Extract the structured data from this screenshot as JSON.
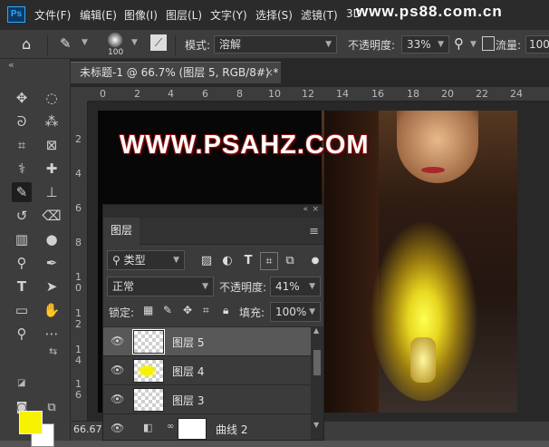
{
  "app": {
    "logo": "Ps"
  },
  "menu": [
    "文件(F)",
    "编辑(E)",
    "图像(I)",
    "图层(L)",
    "文字(Y)",
    "选择(S)",
    "滤镜(T)",
    "3D"
  ],
  "watermark": "www.ps88.com.cn",
  "options": {
    "brush_size": "100",
    "mode_label": "模式:",
    "mode_value": "溶解",
    "opacity_label": "不透明度:",
    "opacity_value": "33%",
    "flow_label": "流量:",
    "flow_value": "100"
  },
  "tools": {
    "expand": "«"
  },
  "document": {
    "tab_title": "未标题-1 @ 66.7% (图层 5, RGB/8#) *",
    "close": "×",
    "ruler_h": [
      "0",
      "2",
      "4",
      "6",
      "8",
      "10",
      "12",
      "14",
      "16",
      "18",
      "20",
      "22",
      "24"
    ],
    "ruler_v": [
      "2",
      "4",
      "6",
      "8",
      "1 0",
      "1 2",
      "1 4",
      "1 6",
      "1 8"
    ],
    "canvas_text": "WWW.PSAHZ.COM",
    "zoom": "66.67"
  },
  "colors": {
    "foreground": "#f7f200",
    "background": "#ffffff",
    "accent": "#31a8ff"
  },
  "layers_panel": {
    "collapse": "«",
    "close": "×",
    "tab": "图层",
    "filter_kind": "类型",
    "blend_mode": "正常",
    "opacity_label": "不透明度:",
    "opacity_value": "41%",
    "lock_label": "锁定:",
    "fill_label": "填充:",
    "fill_value": "100%",
    "layers": [
      {
        "name": "图层 5",
        "selected": true
      },
      {
        "name": "图层 4",
        "selected": false
      },
      {
        "name": "图层 3",
        "selected": false
      },
      {
        "name": "曲线 2",
        "selected": false
      }
    ]
  }
}
